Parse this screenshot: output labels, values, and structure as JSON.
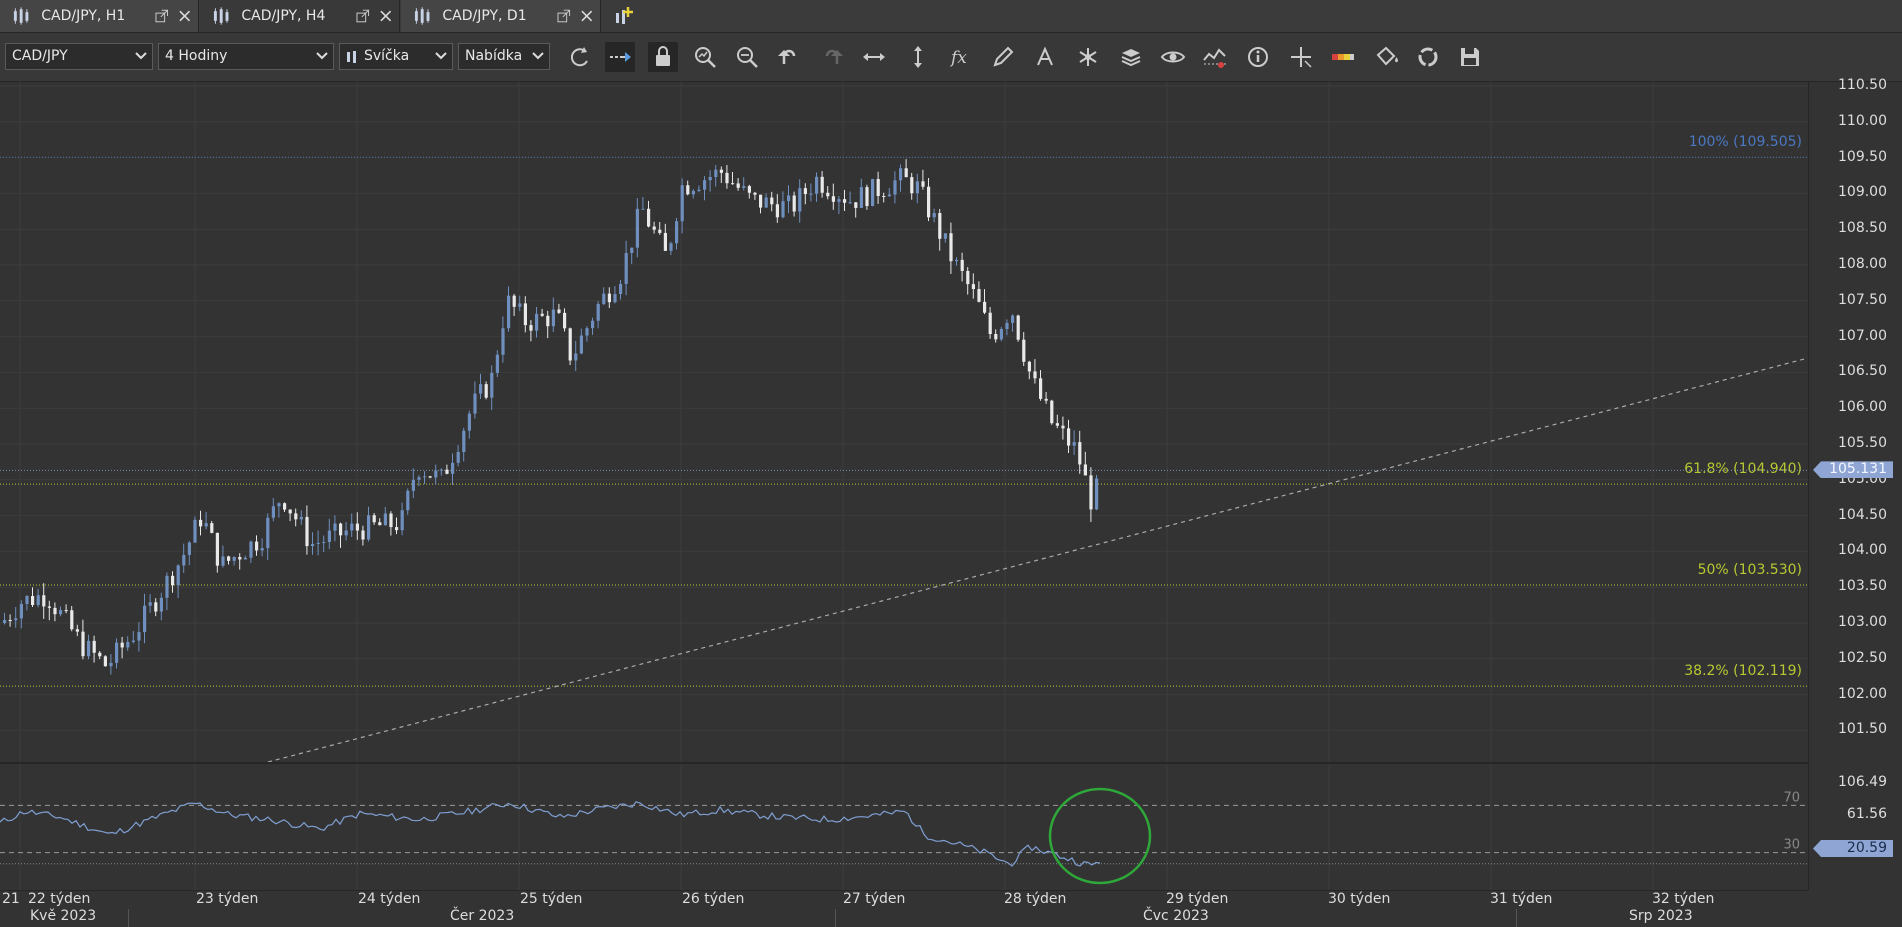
{
  "tabs": [
    {
      "label": "CAD/JPY, H1"
    },
    {
      "label": "CAD/JPY, H4"
    },
    {
      "label": "CAD/JPY, D1"
    }
  ],
  "toolbar": {
    "instrument": "CAD/JPY",
    "period": "4 Hodiny",
    "chart_type": "Svíčka",
    "side": "Nabídka"
  },
  "fib": [
    {
      "label": "100% (109.505)",
      "price": 109.505,
      "color": "#4a78c2"
    },
    {
      "label": "61.8% (104.940)",
      "price": 104.94,
      "color": "#b8c832"
    },
    {
      "label": "50% (103.530)",
      "price": 103.53,
      "color": "#b8c832"
    },
    {
      "label": "38.2% (102.119)",
      "price": 102.119,
      "color": "#b8c832"
    }
  ],
  "price_axis": {
    "ticks": [
      "110.50",
      "110.00",
      "109.50",
      "109.00",
      "108.50",
      "108.00",
      "107.50",
      "107.00",
      "106.50",
      "106.00",
      "105.50",
      "105.00",
      "104.50",
      "104.00",
      "103.50",
      "103.00",
      "102.50",
      "102.00",
      "101.50"
    ],
    "current": "105.131",
    "current_value": 105.131
  },
  "rsi_axis": {
    "ticks": [
      "106.49",
      "61.56"
    ],
    "level_70": "70",
    "level_30": "30",
    "current": "20.59",
    "current_value": 20.59
  },
  "time_axis": {
    "weeks": [
      "21",
      "22 týden",
      "23 týden",
      "24 týden",
      "25 týden",
      "26 týden",
      "27 týden",
      "28 týden",
      "29 týden",
      "30 týden",
      "31 týden",
      "32 týden"
    ],
    "months": [
      "Kvě 2023",
      "Čer 2023",
      "Čvc 2023",
      "Srp 2023"
    ]
  },
  "colors": {
    "bull": "#6f8fbf",
    "bear": "#e9e9e9",
    "rsi": "#7f9fd2",
    "highlight": "#2fa83a"
  }
}
